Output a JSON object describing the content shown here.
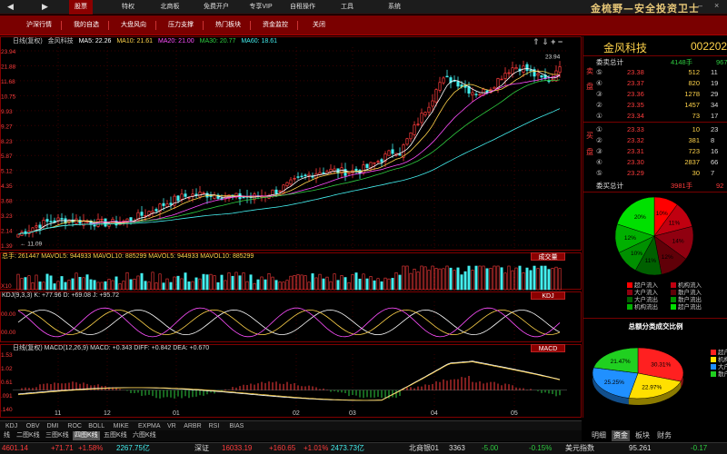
{
  "nav": {
    "items": [
      "股票",
      "特权",
      "北商板",
      "免费开户",
      "专享VIP",
      "自租操作",
      "工具",
      "系统"
    ],
    "active": 0,
    "brand": "金梳野—安全投资卫士"
  },
  "toolbar": {
    "items": [
      "沪深行情",
      "我的自选",
      "大盘风向",
      "压力支撑",
      "热门板块",
      "资金监控",
      "关闭"
    ]
  },
  "kline": {
    "header": [
      "日线(复权)",
      "金风科技"
    ],
    "ma": [
      {
        "label": "MA5: 22.26",
        "color": "#ffffff"
      },
      {
        "label": "MA10: 21.61",
        "color": "#ffd34a"
      },
      {
        "label": "MA20: 21.00",
        "color": "#ff4fff"
      },
      {
        "label": "MA30: 20.77",
        "color": "#2ecc40"
      },
      {
        "label": "MA60: 18.61",
        "color": "#4ee"
      }
    ],
    "yticks": [
      "23.94",
      "21.88",
      "11.68",
      "10.75",
      "9.93",
      "9.27",
      "8.23",
      "5.87",
      "5.12",
      "4.35",
      "3.68",
      "3.23",
      "2.14",
      "1.39"
    ],
    "high_label": "23.94",
    "low_label": "11.09"
  },
  "volume": {
    "header": "总手: 261447  MAVOL5: 944933  MAVOL10: 885299  MAVOL5: 944933  MAVOL10: 885299",
    "tag": "成交量",
    "yticks": [
      "",
      "X10"
    ]
  },
  "kdj": {
    "header": "KDJ(9,3,3)  K: +77.96  D: +69.08  J: +95.72",
    "tag": "KDJ",
    "yticks": [
      "",
      "00.00",
      "00.00"
    ]
  },
  "macd": {
    "header": "日线(复权)   MACD(12,26,9)  MACD: +0.343  DIFF: +0.842  DEA: +0.670",
    "tag": "MACD",
    "yticks": [
      "1.53",
      "1.02",
      "0.61",
      ".091",
      ".140"
    ]
  },
  "xaxis": [
    "11",
    "12",
    "01",
    "02",
    "03",
    "04",
    "05"
  ],
  "indicator_tabs": [
    "KDJ",
    "OBV",
    "DMI",
    "ROC",
    "BOLL",
    "MIKE",
    "EXPMA",
    "VR",
    "ARBR",
    "RSI",
    "BIAS"
  ],
  "period_tabs": [
    "线",
    "二图K线",
    "三图K线",
    "四图K线",
    "五图K线",
    "六图K线"
  ],
  "period_active": 3,
  "stock": {
    "name": "金风科技",
    "code": "002202"
  },
  "sell_side": {
    "title": "委卖总计",
    "total": "4148手",
    "total_extra": "967",
    "label1": "卖",
    "label2": "盘",
    "rows": [
      {
        "lv": "⑤",
        "price": "23.38",
        "vol": "512",
        "x": "11"
      },
      {
        "lv": "④",
        "price": "23.37",
        "vol": "820",
        "x": "19"
      },
      {
        "lv": "③",
        "price": "23.36",
        "vol": "1278",
        "x": "29"
      },
      {
        "lv": "②",
        "price": "23.35",
        "vol": "1457",
        "x": "34"
      },
      {
        "lv": "①",
        "price": "23.34",
        "vol": "73",
        "x": "17"
      }
    ]
  },
  "buy_side": {
    "title": "委买总计",
    "total": "3981手",
    "total_extra": "92",
    "label1": "买",
    "label2": "盘",
    "rows": [
      {
        "lv": "①",
        "price": "23.33",
        "vol": "10",
        "x": "23"
      },
      {
        "lv": "②",
        "price": "23.32",
        "vol": "381",
        "x": "8"
      },
      {
        "lv": "③",
        "price": "23.31",
        "vol": "723",
        "x": "16"
      },
      {
        "lv": "④",
        "price": "23.30",
        "vol": "2837",
        "x": "66"
      },
      {
        "lv": "⑤",
        "price": "23.29",
        "vol": "30",
        "x": "7"
      }
    ]
  },
  "chart_data": [
    {
      "type": "pie",
      "title": "",
      "categories": [
        "超户流入",
        "大户流入",
        "散户流入",
        "机构流入",
        "机构流出",
        "大户流出",
        "散户流出",
        "超户流出"
      ],
      "values": [
        10,
        11,
        14,
        12,
        11,
        10,
        12,
        20
      ],
      "labels": [
        "10%",
        "11%",
        "14%",
        "12%",
        "11%",
        "10%",
        "12%",
        "20%"
      ],
      "colors": [
        "#ff0000",
        "#c00010",
        "#900010",
        "#600008",
        "#006000",
        "#009000",
        "#00b000",
        "#00e000"
      ]
    },
    {
      "type": "pie",
      "title": "总额分类成交比例",
      "categories": [
        "超户",
        "机构",
        "大户",
        "散户"
      ],
      "values": [
        30.31,
        22.97,
        25.25,
        21.47
      ],
      "labels": [
        "30.31%",
        "22.97%",
        "25.25%",
        "21.47%"
      ],
      "colors": [
        "#ff2020",
        "#ffe000",
        "#2090ff",
        "#20d020"
      ]
    }
  ],
  "legend1": [
    "超户流入",
    "机构流入",
    "大户流入",
    "散户流入",
    "大户流出",
    "散户流出",
    "机构流出",
    "超户流出"
  ],
  "legend2": [
    "超户",
    "机构",
    "大户",
    "散户"
  ],
  "right_tabs": [
    "明细",
    "资金",
    "板块",
    "财务"
  ],
  "right_active": 1,
  "ticker": [
    {
      "t": "4601.14",
      "c": "up"
    },
    {
      "t": "+71.71",
      "c": "up"
    },
    {
      "t": "+1.58%",
      "c": "up"
    },
    {
      "t": "2267.75亿",
      "c": "cy"
    },
    {
      "t": "深证",
      "c": "wt"
    },
    {
      "t": "16033.19",
      "c": "up"
    },
    {
      "t": "+160.65",
      "c": "up"
    },
    {
      "t": "+1.01%",
      "c": "up"
    },
    {
      "t": "2473.73亿",
      "c": "cy"
    },
    {
      "t": "北商银01",
      "c": "wt"
    },
    {
      "t": "3363",
      "c": "wt"
    },
    {
      "t": "-5.00",
      "c": "dn"
    },
    {
      "t": "-0.15%",
      "c": "dn"
    },
    {
      "t": "美元指数",
      "c": "wt"
    },
    {
      "t": "95.261",
      "c": "wt"
    },
    {
      "t": "-0.17",
      "c": "dn"
    }
  ]
}
